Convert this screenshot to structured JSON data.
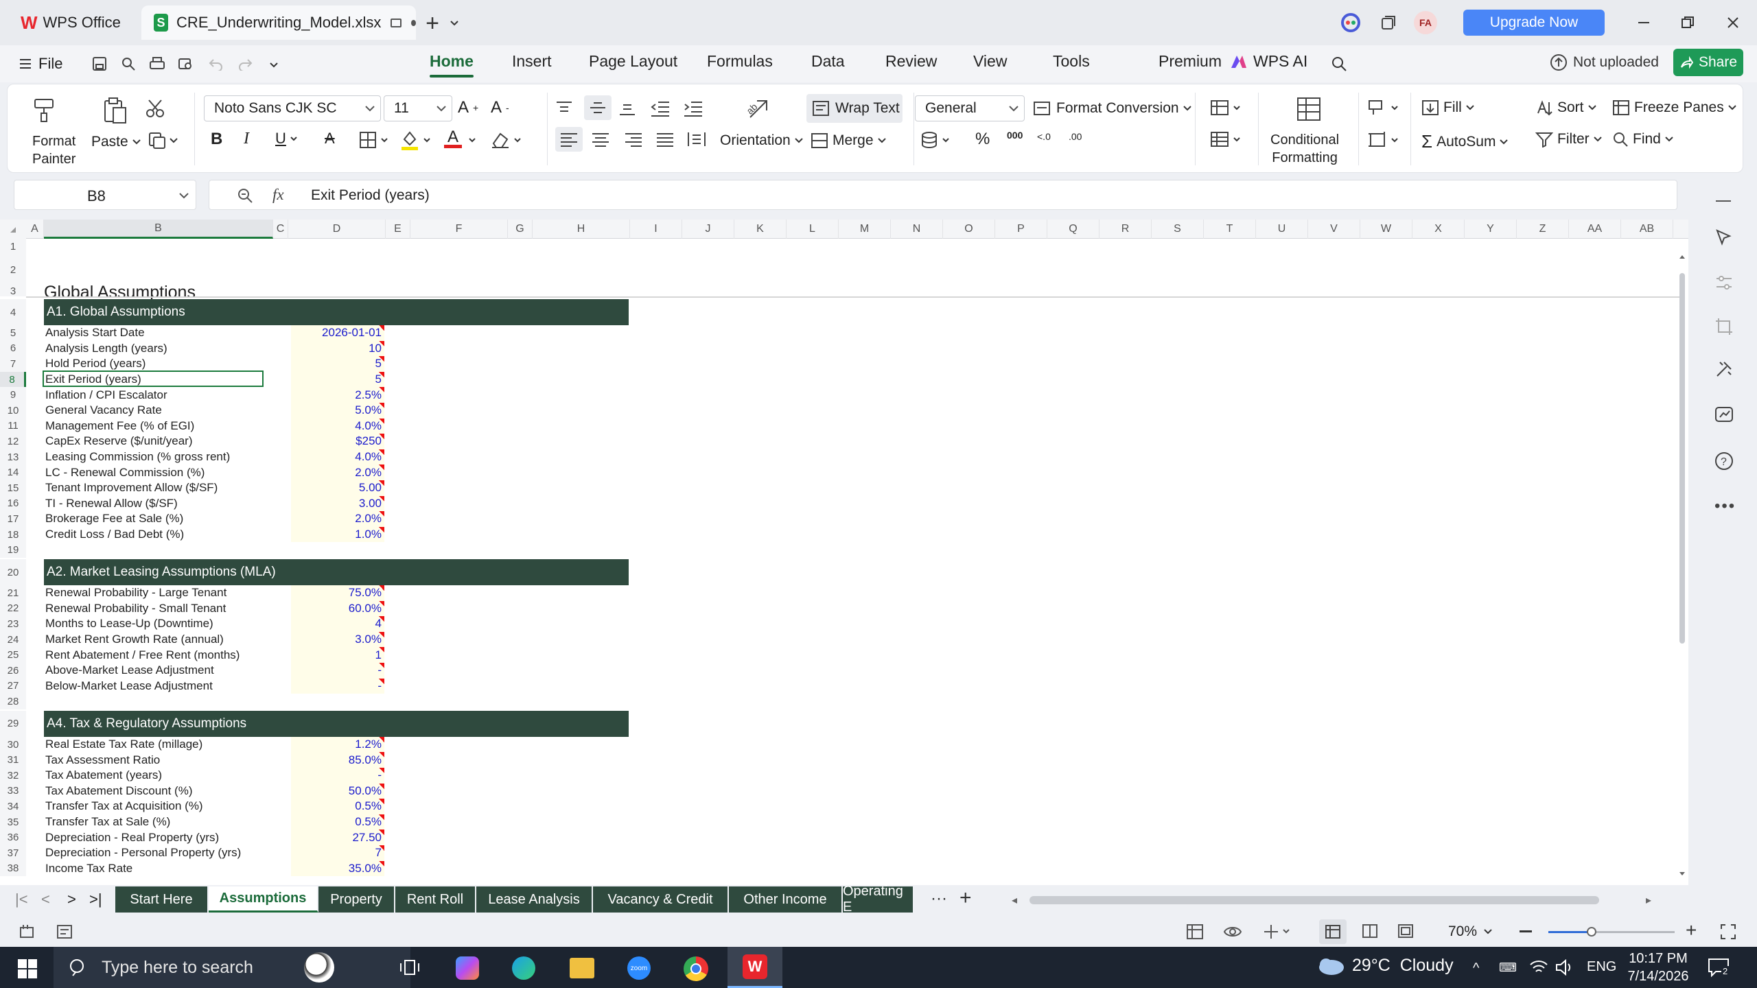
{
  "titlebar": {
    "app_tab": "WPS Office",
    "file_tab": "CRE_Underwriting_Model.xlsx",
    "upgrade": "Upgrade Now",
    "avatar": "FA"
  },
  "menu": {
    "file": "File",
    "tabs": [
      "Home",
      "Insert",
      "Page Layout",
      "Formulas",
      "Data",
      "Review",
      "View",
      "Tools",
      "Premium"
    ],
    "wps_ai": "WPS AI",
    "not_uploaded": "Not uploaded",
    "share": "Share"
  },
  "ribbon": {
    "format_painter_1": "Format",
    "format_painter_2": "Painter",
    "paste": "Paste",
    "font_name": "Noto Sans CJK SC",
    "font_size": "11",
    "wrap_text": "Wrap Text",
    "orientation": "Orientation",
    "merge": "Merge",
    "number_format": "General",
    "format_conversion": "Format Conversion",
    "conditional_1": "Conditional",
    "conditional_2": "Formatting",
    "fill": "Fill",
    "sort": "Sort",
    "freeze": "Freeze Panes",
    "autosum": "AutoSum",
    "filter": "Filter",
    "find": "Find",
    "font_color": "#e02020",
    "highlight_color": "#f5e400"
  },
  "formula_bar": {
    "cell_ref": "B8",
    "fx": "fx",
    "content": "Exit Period (years)"
  },
  "columns": [
    "A",
    "B",
    "C",
    "D",
    "E",
    "F",
    "G",
    "H",
    "I",
    "J",
    "K",
    "L",
    "M",
    "N",
    "O",
    "P",
    "Q",
    "R",
    "S",
    "T",
    "U",
    "V",
    "W",
    "X",
    "Y",
    "Z",
    "AA",
    "AB"
  ],
  "sheet": {
    "title": "Global Assumptions",
    "sections": [
      {
        "header": "A1. Global Assumptions",
        "rows": [
          {
            "r": "5",
            "label": "Analysis Start Date",
            "value": "2026-01-01"
          },
          {
            "r": "6",
            "label": "Analysis Length (years)",
            "value": "10"
          },
          {
            "r": "7",
            "label": "Hold Period (years)",
            "value": "5"
          },
          {
            "r": "8",
            "label": "Exit Period (years)",
            "value": "5"
          },
          {
            "r": "9",
            "label": "Inflation / CPI Escalator",
            "value": "2.5%"
          },
          {
            "r": "10",
            "label": "General Vacancy Rate",
            "value": "5.0%"
          },
          {
            "r": "11",
            "label": "Management Fee (% of EGI)",
            "value": "4.0%"
          },
          {
            "r": "12",
            "label": "CapEx Reserve ($/unit/year)",
            "value": "$250"
          },
          {
            "r": "13",
            "label": "Leasing Commission (% gross rent)",
            "value": "4.0%"
          },
          {
            "r": "14",
            "label": "LC - Renewal Commission (%)",
            "value": "2.0%"
          },
          {
            "r": "15",
            "label": "Tenant Improvement Allow ($/SF)",
            "value": "5.00"
          },
          {
            "r": "16",
            "label": "TI - Renewal Allow ($/SF)",
            "value": "3.00"
          },
          {
            "r": "17",
            "label": "Brokerage Fee at Sale (%)",
            "value": "2.0%"
          },
          {
            "r": "18",
            "label": "Credit Loss / Bad Debt (%)",
            "value": "1.0%"
          }
        ]
      },
      {
        "header": "A2. Market Leasing Assumptions (MLA)",
        "rows": [
          {
            "r": "21",
            "label": "Renewal Probability - Large Tenant",
            "value": "75.0%"
          },
          {
            "r": "22",
            "label": "Renewal Probability - Small Tenant",
            "value": "60.0%"
          },
          {
            "r": "23",
            "label": "Months to Lease-Up (Downtime)",
            "value": "4"
          },
          {
            "r": "24",
            "label": "Market Rent Growth Rate (annual)",
            "value": "3.0%"
          },
          {
            "r": "25",
            "label": "Rent Abatement / Free Rent (months)",
            "value": "1"
          },
          {
            "r": "26",
            "label": "Above-Market Lease Adjustment",
            "value": "-"
          },
          {
            "r": "27",
            "label": "Below-Market Lease Adjustment",
            "value": "-"
          }
        ]
      },
      {
        "header": "A4. Tax & Regulatory Assumptions",
        "rows": [
          {
            "r": "30",
            "label": "Real Estate Tax Rate (millage)",
            "value": "1.2%"
          },
          {
            "r": "31",
            "label": "Tax Assessment Ratio",
            "value": "85.0%"
          },
          {
            "r": "32",
            "label": "Tax Abatement (years)",
            "value": "-"
          },
          {
            "r": "33",
            "label": "Tax Abatement Discount (%)",
            "value": "50.0%"
          },
          {
            "r": "34",
            "label": "Transfer Tax at Acquisition (%)",
            "value": "0.5%"
          },
          {
            "r": "35",
            "label": "Transfer Tax at Sale (%)",
            "value": "0.5%"
          },
          {
            "r": "36",
            "label": "Depreciation - Real Property (yrs)",
            "value": "27.50"
          },
          {
            "r": "37",
            "label": "Depreciation - Personal Property (yrs)",
            "value": "7"
          },
          {
            "r": "38",
            "label": "Income Tax Rate",
            "value": "35.0%"
          }
        ]
      }
    ]
  },
  "sheet_tabs": [
    "Start Here",
    "Assumptions",
    "Property",
    "Rent Roll",
    "Lease Analysis",
    "Vacancy & Credit",
    "Other Income",
    "Operating E"
  ],
  "status": {
    "zoom": "70%"
  },
  "taskbar": {
    "search": "Type here to search",
    "weather": "29°C  Cloudy",
    "lang": "ENG",
    "time": "10:17 PM",
    "date": "7/14/2026",
    "notif": "2"
  }
}
